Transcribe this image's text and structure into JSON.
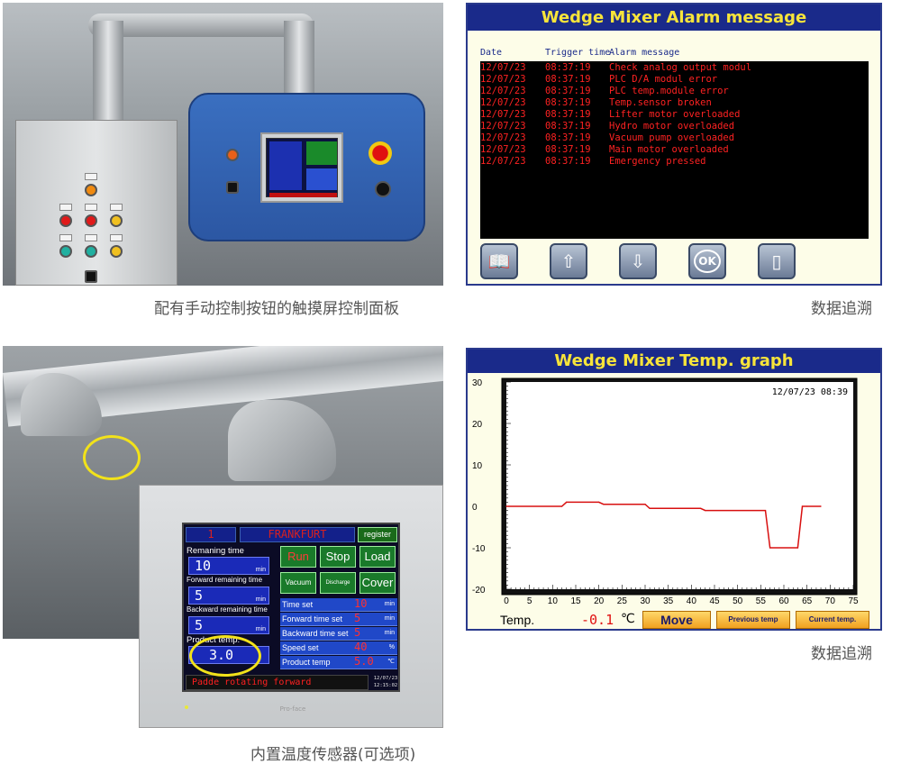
{
  "captions": {
    "panel": "配有手动控制按钮的触摸屏控制面板",
    "alarm": "数据追溯",
    "sensor": "内置温度传感器(可选项)",
    "graph": "数据追溯"
  },
  "alarm_screen": {
    "title": "Wedge Mixer Alarm message",
    "headers": {
      "date": "Date",
      "trigger": "Trigger time",
      "message": "Alarm message"
    },
    "rows": [
      {
        "date": "12/07/23",
        "time": "08:37:19",
        "message": "Check analog output modul"
      },
      {
        "date": "12/07/23",
        "time": "08:37:19",
        "message": "PLC D/A modul error"
      },
      {
        "date": "12/07/23",
        "time": "08:37:19",
        "message": "PLC temp.module error"
      },
      {
        "date": "12/07/23",
        "time": "08:37:19",
        "message": "Temp.sensor broken"
      },
      {
        "date": "12/07/23",
        "time": "08:37:19",
        "message": "Lifter motor overloaded"
      },
      {
        "date": "12/07/23",
        "time": "08:37:19",
        "message": "Hydro motor overloaded"
      },
      {
        "date": "12/07/23",
        "time": "08:37:19",
        "message": "Vacuum pump overloaded"
      },
      {
        "date": "12/07/23",
        "time": "08:37:19",
        "message": "Main motor overloaded"
      },
      {
        "date": "12/07/23",
        "time": "08:37:19",
        "message": "Emergency pressed"
      }
    ],
    "buttons": [
      {
        "icon": "open-book-icon",
        "glyph": "📖"
      },
      {
        "icon": "page-up-icon",
        "glyph": "⇧"
      },
      {
        "icon": "page-down-icon",
        "glyph": "⇩"
      },
      {
        "icon": "ok-icon",
        "glyph": "OK"
      },
      {
        "icon": "blank-page-icon",
        "glyph": "▯"
      }
    ]
  },
  "hmi_screen": {
    "batch": "1",
    "name": "FRANKFURT",
    "register": "register",
    "remaining_label": "Remaning time",
    "remaining_value": "10",
    "forward_label": "Forward remaining time",
    "forward_value": "5",
    "backward_label": "Backward remaining time",
    "backward_value": "5",
    "product_label": "Product temp.",
    "product_value": "3.0",
    "unit_min": "min",
    "buttons": {
      "run": "Run",
      "stop": "Stop",
      "load": "Load",
      "vacuum": "Vacuum",
      "discharge": "Discharge",
      "cover": "Cover"
    },
    "settings": [
      {
        "label": "Time set",
        "value": "10",
        "unit": "min"
      },
      {
        "label": "Forward time set",
        "value": "5",
        "unit": "min"
      },
      {
        "label": "Backward time set",
        "value": "5",
        "unit": "min"
      },
      {
        "label": "Speed set",
        "value": "40",
        "unit": "%"
      },
      {
        "label": "Product temp",
        "value": "5.0",
        "unit": "℃"
      }
    ],
    "status": "Padde rotating forward",
    "stamp_date": "12/07/23",
    "stamp_time": "12:15:02",
    "brand": "Pro-face"
  },
  "graph_screen": {
    "title": "Wedge Mixer Temp. graph",
    "timestamp": "12/07/23 08:39",
    "temp_label": "Temp.",
    "temp_value": "-0.1",
    "temp_unit": "℃",
    "buttons": {
      "move": "Move",
      "previous": "Previous temp",
      "current": "Current temp."
    }
  },
  "chart_data": {
    "type": "line",
    "title": "Wedge Mixer Temp. graph",
    "xlabel": "",
    "ylabel": "",
    "xlim": [
      0,
      75
    ],
    "ylim": [
      -20,
      30
    ],
    "x_ticks": [
      0,
      5,
      10,
      15,
      20,
      25,
      30,
      35,
      40,
      45,
      50,
      55,
      60,
      65,
      70,
      75
    ],
    "y_ticks": [
      30,
      20,
      10,
      0,
      -10,
      -20
    ],
    "series": [
      {
        "color": "#d81010",
        "x": [
          0,
          12,
          13,
          20,
          21,
          30,
          31,
          42,
          43,
          56,
          57,
          63,
          64,
          65,
          68
        ],
        "y": [
          0,
          0,
          1,
          1,
          0.5,
          0.5,
          -0.5,
          -0.5,
          -1,
          -1,
          -10,
          -10,
          0,
          0,
          0
        ]
      }
    ]
  }
}
